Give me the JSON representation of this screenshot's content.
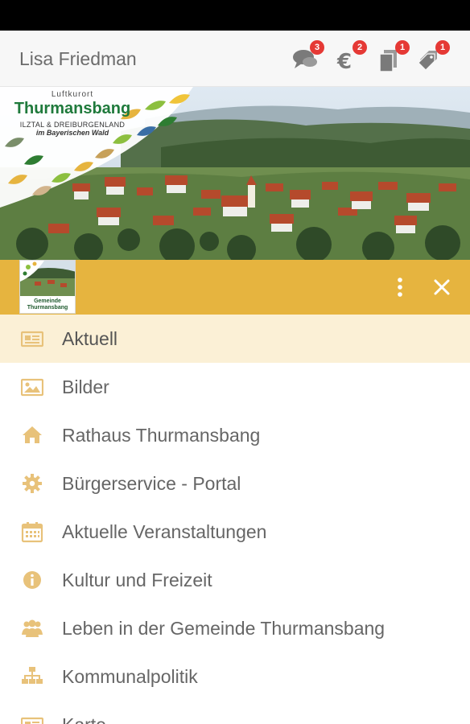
{
  "header": {
    "user_name": "Lisa Friedman",
    "actions": [
      {
        "icon": "chat-icon",
        "badge": "3"
      },
      {
        "icon": "euro-icon",
        "badge": "2"
      },
      {
        "icon": "documents-icon",
        "badge": "1"
      },
      {
        "icon": "tags-icon",
        "badge": "1"
      }
    ]
  },
  "banner": {
    "logo_top": "Luftkurort",
    "logo_name": "Thurmansbang",
    "logo_sub1": "ILZTAL & DREIBURGENLAND",
    "logo_sub2": "im Bayerischen Wald"
  },
  "drawer": {
    "thumb_caption_1": "Gemeinde",
    "thumb_caption_2": "Thurmansbang",
    "more_icon": "more-vert-icon",
    "close_icon": "close-icon"
  },
  "menu": {
    "items": [
      {
        "label": "Aktuell",
        "icon": "newspaper-icon",
        "active": true
      },
      {
        "label": "Bilder",
        "icon": "image-icon"
      },
      {
        "label": "Rathaus Thurmansbang",
        "icon": "home-icon"
      },
      {
        "label": "Bürgerservice - Portal",
        "icon": "gear-icon"
      },
      {
        "label": "Aktuelle Veranstaltungen",
        "icon": "calendar-icon"
      },
      {
        "label": "Kultur und Freizeit",
        "icon": "info-icon"
      },
      {
        "label": "Leben in der Gemeinde Thurmansbang",
        "icon": "users-icon"
      },
      {
        "label": "Kommunalpolitik",
        "icon": "sitemap-icon"
      },
      {
        "label": "Karte",
        "icon": "newspaper-icon"
      }
    ]
  },
  "colors": {
    "accent": "#e6b43f",
    "icon": "#e8c27a",
    "active_row": "#fbf0d6",
    "badge": "#e53935"
  }
}
